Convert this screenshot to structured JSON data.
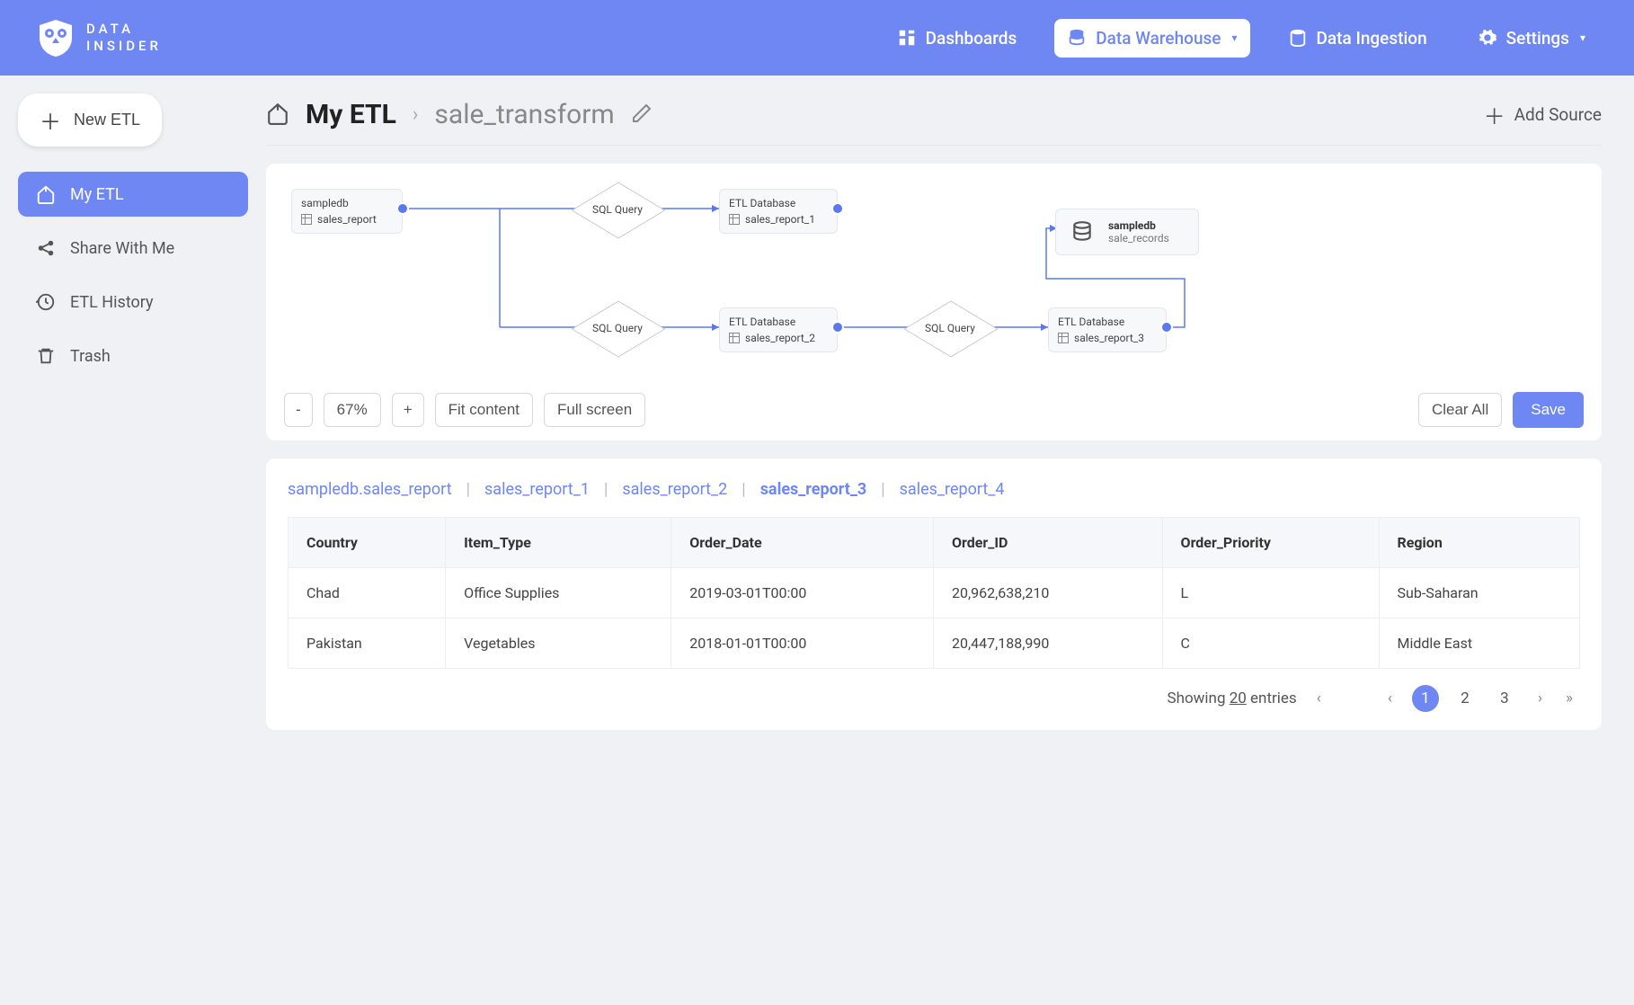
{
  "brand": {
    "line1": "DATA",
    "line2": "INSIDER"
  },
  "nav": {
    "dashboards": "Dashboards",
    "warehouse": "Data Warehouse",
    "ingestion": "Data Ingestion",
    "settings": "Settings"
  },
  "sidebar": {
    "new_label": "New ETL",
    "items": [
      {
        "label": "My ETL",
        "active": true
      },
      {
        "label": "Share With Me",
        "active": false
      },
      {
        "label": "ETL History",
        "active": false
      },
      {
        "label": "Trash",
        "active": false
      }
    ]
  },
  "breadcrumb": {
    "root": "My ETL",
    "current": "sale_transform"
  },
  "add_source": "Add Source",
  "flow": {
    "source": {
      "top": "sampledb",
      "bottom": "sales_report"
    },
    "sql1": "SQL Query",
    "db1": {
      "top": "ETL Database",
      "bottom": "sales_report_1"
    },
    "sql2": "SQL Query",
    "db2": {
      "top": "ETL Database",
      "bottom": "sales_report_2"
    },
    "sql3": "SQL Query",
    "db3": {
      "top": "ETL Database",
      "bottom": "sales_report_3"
    },
    "dest": {
      "top": "sampledb",
      "sub": "sale_records"
    }
  },
  "toolbar": {
    "zoom_out": "-",
    "zoom_val": "67%",
    "zoom_in": "+",
    "fit": "Fit content",
    "full": "Full screen",
    "clear": "Clear All",
    "save": "Save"
  },
  "tabs": [
    "sampledb.sales_report",
    "sales_report_1",
    "sales_report_2",
    "sales_report_3",
    "sales_report_4"
  ],
  "active_tab_index": 3,
  "table": {
    "headers": [
      "Country",
      "Item_Type",
      "Order_Date",
      "Order_ID",
      "Order_Priority",
      "Region"
    ],
    "rows": [
      [
        "Chad",
        "Office Supplies",
        "2019-03-01T00:00",
        "20,962,638,210",
        "L",
        "Sub-Saharan"
      ],
      [
        "Pakistan",
        "Vegetables",
        "2018-01-01T00:00",
        "20,447,188,990",
        "C",
        "Middle East"
      ]
    ]
  },
  "pagination": {
    "showing_prefix": "Showing",
    "count": "20",
    "showing_suffix": "entries",
    "pages": [
      "1",
      "2",
      "3"
    ],
    "active_page": 0
  }
}
